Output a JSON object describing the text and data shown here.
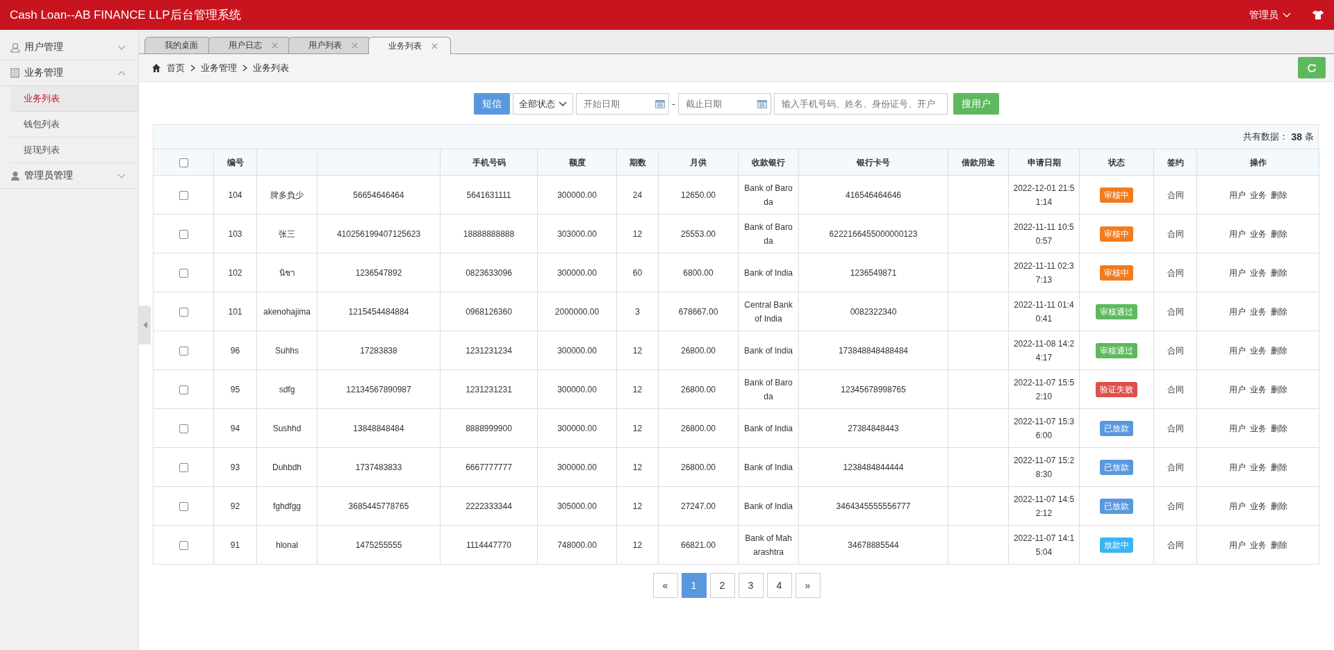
{
  "header": {
    "title": "Cash Loan--AB FINANCE LLP后台管理系统",
    "user": "管理员"
  },
  "sidebar": {
    "groups": [
      {
        "label": "用户管理",
        "expanded": false
      },
      {
        "label": "业务管理",
        "expanded": true,
        "children": [
          {
            "label": "业务列表",
            "selected": true
          },
          {
            "label": "钱包列表",
            "selected": false
          },
          {
            "label": "提现列表",
            "selected": false
          }
        ]
      },
      {
        "label": "管理员管理",
        "expanded": false
      }
    ]
  },
  "tabs": [
    {
      "label": "我的桌面",
      "selected": false,
      "closable": false
    },
    {
      "label": "用户日志",
      "selected": false,
      "closable": true
    },
    {
      "label": "用户列表",
      "selected": false,
      "closable": true
    },
    {
      "label": "业务列表",
      "selected": true,
      "closable": true
    }
  ],
  "breadcrumb": [
    "首页",
    "业务管理",
    "业务列表"
  ],
  "toolbar": {
    "sms_button": "短信",
    "status_filter": "全部状态",
    "start_date": {
      "placeholder": "开始日期"
    },
    "separator": "-",
    "end_date": {
      "placeholder": "截止日期"
    },
    "search": {
      "placeholder": "输入手机号码、姓名、身份证号、开户"
    },
    "search_button": "搜用户"
  },
  "table": {
    "all_checked": false,
    "total_label": "共有数据：",
    "total": "38",
    "total_unit": "条",
    "columns": [
      "",
      "编号",
      "",
      "",
      "手机号码",
      "额度",
      "期数",
      "月供",
      "收款银行",
      "银行卡号",
      "借款用途",
      "申请日期",
      "状态",
      "签约",
      "操作"
    ],
    "rows": [
      {
        "checked": false,
        "id": "104",
        "name": "脾多負少",
        "id_number": "56654646464",
        "phone": "5641631111",
        "amount": "300000.00",
        "terms": "24",
        "monthly": "12650.00",
        "bank": "Bank of Baroda",
        "card": "416546464646",
        "purpose": "",
        "date": "2022-12-01 21:51:14",
        "status": {
          "label": "审核中",
          "color": "#f37b1d"
        },
        "contract": "合同",
        "actions": [
          "用户",
          "业务",
          "删除"
        ]
      },
      {
        "checked": false,
        "id": "103",
        "name": "张三",
        "id_number": "410256199407125623",
        "phone": "18888888888",
        "amount": "303000.00",
        "terms": "12",
        "monthly": "25553.00",
        "bank": "Bank of Baroda",
        "card": "6222166455000000123",
        "purpose": "",
        "date": "2022-11-11 10:50:57",
        "status": {
          "label": "审核中",
          "color": "#f37b1d"
        },
        "contract": "合同",
        "actions": [
          "用户",
          "业务",
          "删除"
        ]
      },
      {
        "checked": false,
        "id": "102",
        "name": "นิชา",
        "id_number": "1236547892",
        "phone": "0823633096",
        "amount": "300000.00",
        "terms": "60",
        "monthly": "6800.00",
        "bank": "Bank of India",
        "card": "1236549871",
        "purpose": "",
        "date": "2022-11-11 02:37:13",
        "status": {
          "label": "审核中",
          "color": "#f37b1d"
        },
        "contract": "合同",
        "actions": [
          "用户",
          "业务",
          "删除"
        ]
      },
      {
        "checked": false,
        "id": "101",
        "name": "akenohajima",
        "id_number": "1215454484884",
        "phone": "0968126360",
        "amount": "2000000.00",
        "terms": "3",
        "monthly": "678667.00",
        "bank": "Central Bank of India",
        "card": "0082322340",
        "purpose": "",
        "date": "2022-11-11 01:40:41",
        "status": {
          "label": "审核通过",
          "color": "#5eb95e"
        },
        "contract": "合同",
        "actions": [
          "用户",
          "业务",
          "删除"
        ]
      },
      {
        "checked": false,
        "id": "96",
        "name": "Suhhs",
        "id_number": "17283838",
        "phone": "1231231234",
        "amount": "300000.00",
        "terms": "12",
        "monthly": "26800.00",
        "bank": "Bank of India",
        "card": "173848848488484",
        "purpose": "",
        "date": "2022-11-08 14:24:17",
        "status": {
          "label": "审核通过",
          "color": "#5eb95e"
        },
        "contract": "合同",
        "actions": [
          "用户",
          "业务",
          "删除"
        ]
      },
      {
        "checked": false,
        "id": "95",
        "name": "sdfg",
        "id_number": "12134567890987",
        "phone": "1231231231",
        "amount": "300000.00",
        "terms": "12",
        "monthly": "26800.00",
        "bank": "Bank of Baroda",
        "card": "12345678998765",
        "purpose": "",
        "date": "2022-11-07 15:52:10",
        "status": {
          "label": "验证失败",
          "color": "#dd514c"
        },
        "contract": "合同",
        "actions": [
          "用户",
          "业务",
          "删除"
        ]
      },
      {
        "checked": false,
        "id": "94",
        "name": "Sushhd",
        "id_number": "13848848484",
        "phone": "8888999900",
        "amount": "300000.00",
        "terms": "12",
        "monthly": "26800.00",
        "bank": "Bank of India",
        "card": "27384848443",
        "purpose": "",
        "date": "2022-11-07 15:36:00",
        "status": {
          "label": "已放款",
          "color": "#5a98de"
        },
        "contract": "合同",
        "actions": [
          "用户",
          "业务",
          "删除"
        ]
      },
      {
        "checked": false,
        "id": "93",
        "name": "Duhbdh",
        "id_number": "1737483833",
        "phone": "6667777777",
        "amount": "300000.00",
        "terms": "12",
        "monthly": "26800.00",
        "bank": "Bank of India",
        "card": "1238484844444",
        "purpose": "",
        "date": "2022-11-07 15:28:30",
        "status": {
          "label": "已放款",
          "color": "#5a98de"
        },
        "contract": "合同",
        "actions": [
          "用户",
          "业务",
          "删除"
        ]
      },
      {
        "checked": false,
        "id": "92",
        "name": "fghdfgg",
        "id_number": "3685445778765",
        "phone": "2222333344",
        "amount": "305000.00",
        "terms": "12",
        "monthly": "27247.00",
        "bank": "Bank of India",
        "card": "3464345555556777",
        "purpose": "",
        "date": "2022-11-07 14:52:12",
        "status": {
          "label": "已放款",
          "color": "#5a98de"
        },
        "contract": "合同",
        "actions": [
          "用户",
          "业务",
          "删除"
        ]
      },
      {
        "checked": false,
        "id": "91",
        "name": "hlonal",
        "id_number": "1475255555",
        "phone": "1114447770",
        "amount": "748000.00",
        "terms": "12",
        "monthly": "66821.00",
        "bank": "Bank of Maharashtra",
        "card": "34678885544",
        "purpose": "",
        "date": "2022-11-07 14:15:04",
        "status": {
          "label": "放款中",
          "color": "#3bb4f2"
        },
        "contract": "合同",
        "actions": [
          "用户",
          "业务",
          "删除"
        ]
      }
    ]
  },
  "pagination": {
    "prev": "«",
    "pages": [
      {
        "label": "1",
        "selected": true
      },
      {
        "label": "2",
        "selected": false
      },
      {
        "label": "3",
        "selected": false
      },
      {
        "label": "4",
        "selected": false
      }
    ],
    "next": "»"
  }
}
